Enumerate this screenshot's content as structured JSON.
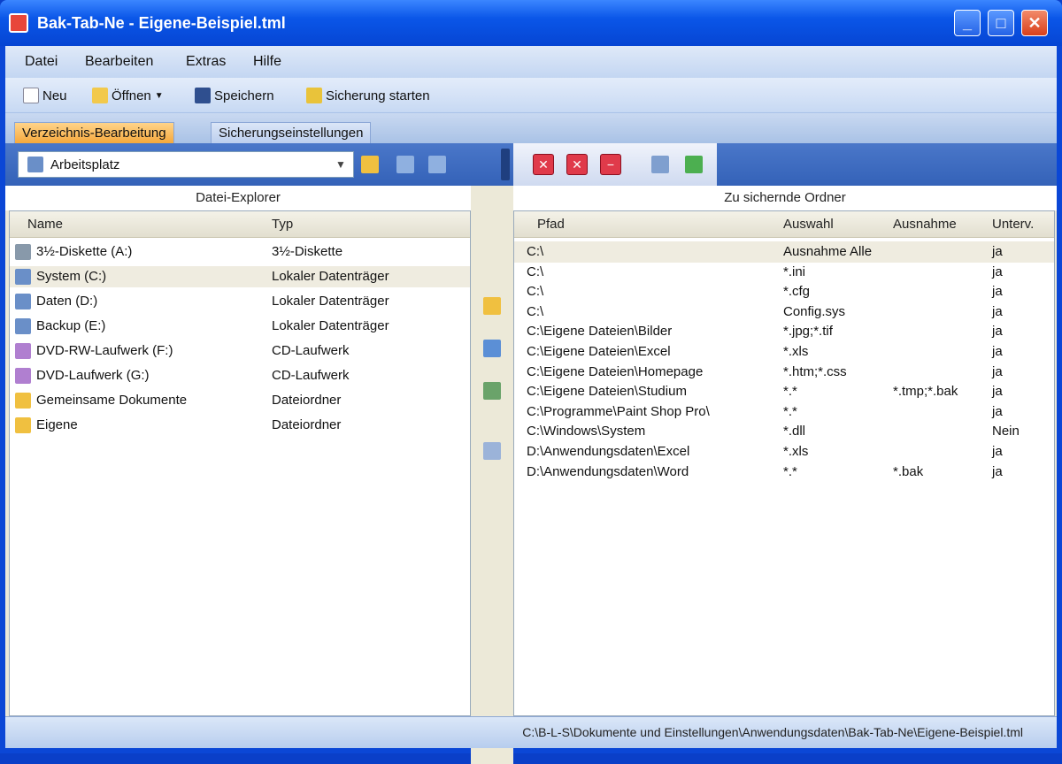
{
  "window": {
    "title": "Bak-Tab-Ne - Eigene-Beispiel.tml"
  },
  "menu": [
    "Datei",
    "Bearbeiten",
    "Extras",
    "Hilfe"
  ],
  "toolbar": {
    "new_label": "Neu",
    "open_label": "Öffnen",
    "save_label": "Speichern",
    "start_label": "Sicherung starten"
  },
  "tabs": {
    "active": "Verzeichnis-Bearbeitung",
    "inactive": "Sicherungseinstellungen"
  },
  "navbar": {
    "location": "Arbeitsplatz"
  },
  "left_pane": {
    "header": "Datei-Explorer",
    "columns": [
      "Name",
      "Typ"
    ],
    "rows": [
      {
        "name": "3½-Diskette (A:)",
        "type": "3½-Diskette"
      },
      {
        "name": "System (C:)",
        "type": "Lokaler Datenträger"
      },
      {
        "name": "Daten (D:)",
        "type": "Lokaler Datenträger"
      },
      {
        "name": "Backup (E:)",
        "type": "Lokaler Datenträger"
      },
      {
        "name": "DVD-RW-Laufwerk (F:)",
        "type": "CD-Laufwerk"
      },
      {
        "name": "DVD-Laufwerk (G:)",
        "type": "CD-Laufwerk"
      },
      {
        "name": "Gemeinsame Dokumente",
        "type": "Dateiordner"
      },
      {
        "name": "Eigene",
        "type": "Dateiordner"
      }
    ]
  },
  "right_pane": {
    "header": "Zu sichernde Ordner",
    "columns": [
      "Pfad",
      "Auswahl",
      "Ausnahme",
      "Unterv."
    ],
    "rows": [
      {
        "path": "C:\\",
        "select": "Ausnahme Alle",
        "exclude": "",
        "sub": "ja"
      },
      {
        "path": "C:\\",
        "select": "*.ini",
        "exclude": "",
        "sub": "ja"
      },
      {
        "path": "C:\\",
        "select": "*.cfg",
        "exclude": "",
        "sub": "ja"
      },
      {
        "path": "C:\\",
        "select": "Config.sys",
        "exclude": "",
        "sub": "ja"
      },
      {
        "path": "C:\\Eigene Dateien\\Bilder",
        "select": "*.jpg;*.tif",
        "exclude": "",
        "sub": "ja"
      },
      {
        "path": "C:\\Eigene Dateien\\Excel",
        "select": "*.xls",
        "exclude": "",
        "sub": "ja"
      },
      {
        "path": "C:\\Eigene Dateien\\Homepage",
        "select": "*.htm;*.css",
        "exclude": "",
        "sub": "ja"
      },
      {
        "path": "C:\\Eigene Dateien\\Studium",
        "select": "*.*",
        "exclude": "*.tmp;*.bak",
        "sub": "ja"
      },
      {
        "path": "C:\\Programme\\Paint Shop Pro\\",
        "select": "*.*",
        "exclude": "",
        "sub": "ja"
      },
      {
        "path": "C:\\Windows\\System",
        "select": "*.dll",
        "exclude": "",
        "sub": "Nein"
      },
      {
        "path": "D:\\Anwendungsdaten\\Excel",
        "select": "*.xls",
        "exclude": "",
        "sub": "ja"
      },
      {
        "path": "D:\\Anwendungsdaten\\Word",
        "select": "*.*",
        "exclude": "*.bak",
        "sub": "ja"
      }
    ]
  },
  "status": {
    "text": "C:\\B-L-S\\Dokumente und Einstellungen\\Anwendungsdaten\\Bak-Tab-Ne\\Eigene-Beispiel.tml"
  },
  "colors": {
    "title_blue": "#0a56e8",
    "active_tab": "#f5a83c",
    "red_button": "#e03a4a"
  }
}
